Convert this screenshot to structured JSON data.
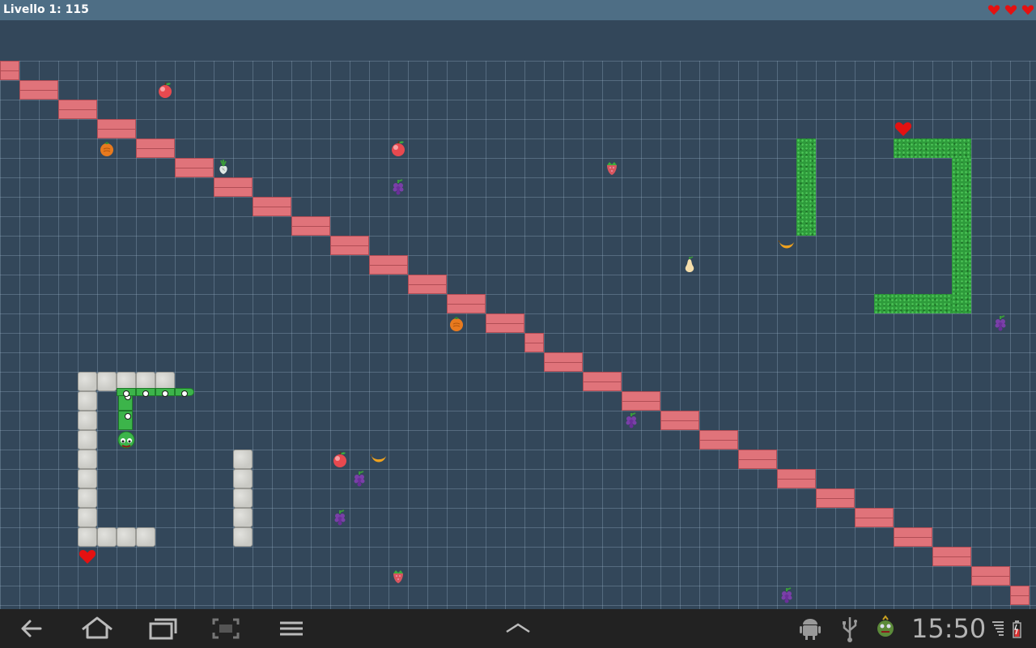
{
  "window": {
    "title": "Livello 1: 115",
    "lives": 3
  },
  "colors": {
    "brick": "#e0737a",
    "brick_line": "#b14d55",
    "stone": "#c9c9c4",
    "hedge": "#2e9b3b",
    "snake": "#3cb44a",
    "heart": "#e41111"
  },
  "board": {
    "cols": 53,
    "rows": 28,
    "cell_size": 24,
    "bricks": [
      {
        "col": 0,
        "row": 0,
        "w": 1
      },
      {
        "col": 1,
        "row": 1,
        "w": 2
      },
      {
        "col": 3,
        "row": 2,
        "w": 2
      },
      {
        "col": 5,
        "row": 3,
        "w": 2
      },
      {
        "col": 7,
        "row": 4,
        "w": 2
      },
      {
        "col": 9,
        "row": 5,
        "w": 2
      },
      {
        "col": 11,
        "row": 6,
        "w": 2
      },
      {
        "col": 13,
        "row": 7,
        "w": 2
      },
      {
        "col": 15,
        "row": 8,
        "w": 2
      },
      {
        "col": 17,
        "row": 9,
        "w": 2
      },
      {
        "col": 19,
        "row": 10,
        "w": 2
      },
      {
        "col": 21,
        "row": 11,
        "w": 2
      },
      {
        "col": 23,
        "row": 12,
        "w": 2
      },
      {
        "col": 25,
        "row": 13,
        "w": 2
      },
      {
        "col": 27,
        "row": 14,
        "w": 1
      },
      {
        "col": 28,
        "row": 15,
        "w": 2
      },
      {
        "col": 30,
        "row": 16,
        "w": 2
      },
      {
        "col": 32,
        "row": 17,
        "w": 2
      },
      {
        "col": 34,
        "row": 18,
        "w": 2
      },
      {
        "col": 36,
        "row": 19,
        "w": 2
      },
      {
        "col": 38,
        "row": 20,
        "w": 2
      },
      {
        "col": 40,
        "row": 21,
        "w": 2
      },
      {
        "col": 42,
        "row": 22,
        "w": 2
      },
      {
        "col": 44,
        "row": 23,
        "w": 2
      },
      {
        "col": 46,
        "row": 24,
        "w": 2
      },
      {
        "col": 48,
        "row": 25,
        "w": 2
      },
      {
        "col": 50,
        "row": 26,
        "w": 2
      },
      {
        "col": 52,
        "row": 27,
        "w": 1
      }
    ],
    "stones": [
      {
        "col": 4,
        "row": 16
      },
      {
        "col": 5,
        "row": 16
      },
      {
        "col": 6,
        "row": 16
      },
      {
        "col": 7,
        "row": 16
      },
      {
        "col": 8,
        "row": 16
      },
      {
        "col": 4,
        "row": 17
      },
      {
        "col": 4,
        "row": 18
      },
      {
        "col": 4,
        "row": 19
      },
      {
        "col": 4,
        "row": 20
      },
      {
        "col": 4,
        "row": 21
      },
      {
        "col": 4,
        "row": 22
      },
      {
        "col": 4,
        "row": 23
      },
      {
        "col": 4,
        "row": 24
      },
      {
        "col": 5,
        "row": 24
      },
      {
        "col": 6,
        "row": 24
      },
      {
        "col": 7,
        "row": 24
      },
      {
        "col": 12,
        "row": 20
      },
      {
        "col": 12,
        "row": 21
      },
      {
        "col": 12,
        "row": 22
      },
      {
        "col": 12,
        "row": 23
      },
      {
        "col": 12,
        "row": 24
      }
    ],
    "hedges": [
      {
        "col": 41,
        "row": 4,
        "w": 1,
        "h": 5
      },
      {
        "col": 46,
        "row": 4,
        "w": 4,
        "h": 1
      },
      {
        "col": 49,
        "row": 5,
        "w": 1,
        "h": 8
      },
      {
        "col": 45,
        "row": 12,
        "w": 4,
        "h": 1
      }
    ],
    "items": [
      {
        "kind": "apple",
        "col": 8,
        "row": 1
      },
      {
        "kind": "orange",
        "col": 5,
        "row": 4
      },
      {
        "kind": "radish",
        "col": 11,
        "row": 5
      },
      {
        "kind": "apple",
        "col": 20,
        "row": 4
      },
      {
        "kind": "grapes",
        "col": 20,
        "row": 6
      },
      {
        "kind": "strawberry",
        "col": 31,
        "row": 5
      },
      {
        "kind": "banana",
        "col": 40,
        "row": 9
      },
      {
        "kind": "pear",
        "col": 35,
        "row": 10
      },
      {
        "kind": "heart",
        "col": 46,
        "row": 3
      },
      {
        "kind": "grapes",
        "col": 51,
        "row": 13
      },
      {
        "kind": "orange",
        "col": 23,
        "row": 13
      },
      {
        "kind": "grapes",
        "col": 32,
        "row": 18
      },
      {
        "kind": "apple",
        "col": 17,
        "row": 20
      },
      {
        "kind": "banana",
        "col": 19,
        "row": 20
      },
      {
        "kind": "grapes",
        "col": 18,
        "row": 21
      },
      {
        "kind": "grapes",
        "col": 17,
        "row": 23
      },
      {
        "kind": "heart",
        "col": 4,
        "row": 25
      },
      {
        "kind": "strawberry",
        "col": 20,
        "row": 26
      },
      {
        "kind": "grapes",
        "col": 40,
        "row": 27
      }
    ],
    "snake": {
      "head": {
        "col": 6,
        "row": 19
      },
      "body": [
        {
          "col": 6,
          "row": 18
        },
        {
          "col": 6,
          "row": 17
        },
        {
          "col": 6,
          "row": 16.85
        },
        {
          "col": 7,
          "row": 16.85
        },
        {
          "col": 8,
          "row": 16.85
        },
        {
          "col": 9,
          "row": 16.85
        }
      ]
    }
  },
  "navbar": {
    "buttons": [
      "back-icon",
      "home-icon",
      "recent-apps-icon",
      "screenshot-icon",
      "menu-icon",
      "expand-up-icon"
    ],
    "status": [
      "android-debug-icon",
      "usb-icon",
      "app-notification-icon"
    ],
    "clock": "15:50"
  }
}
